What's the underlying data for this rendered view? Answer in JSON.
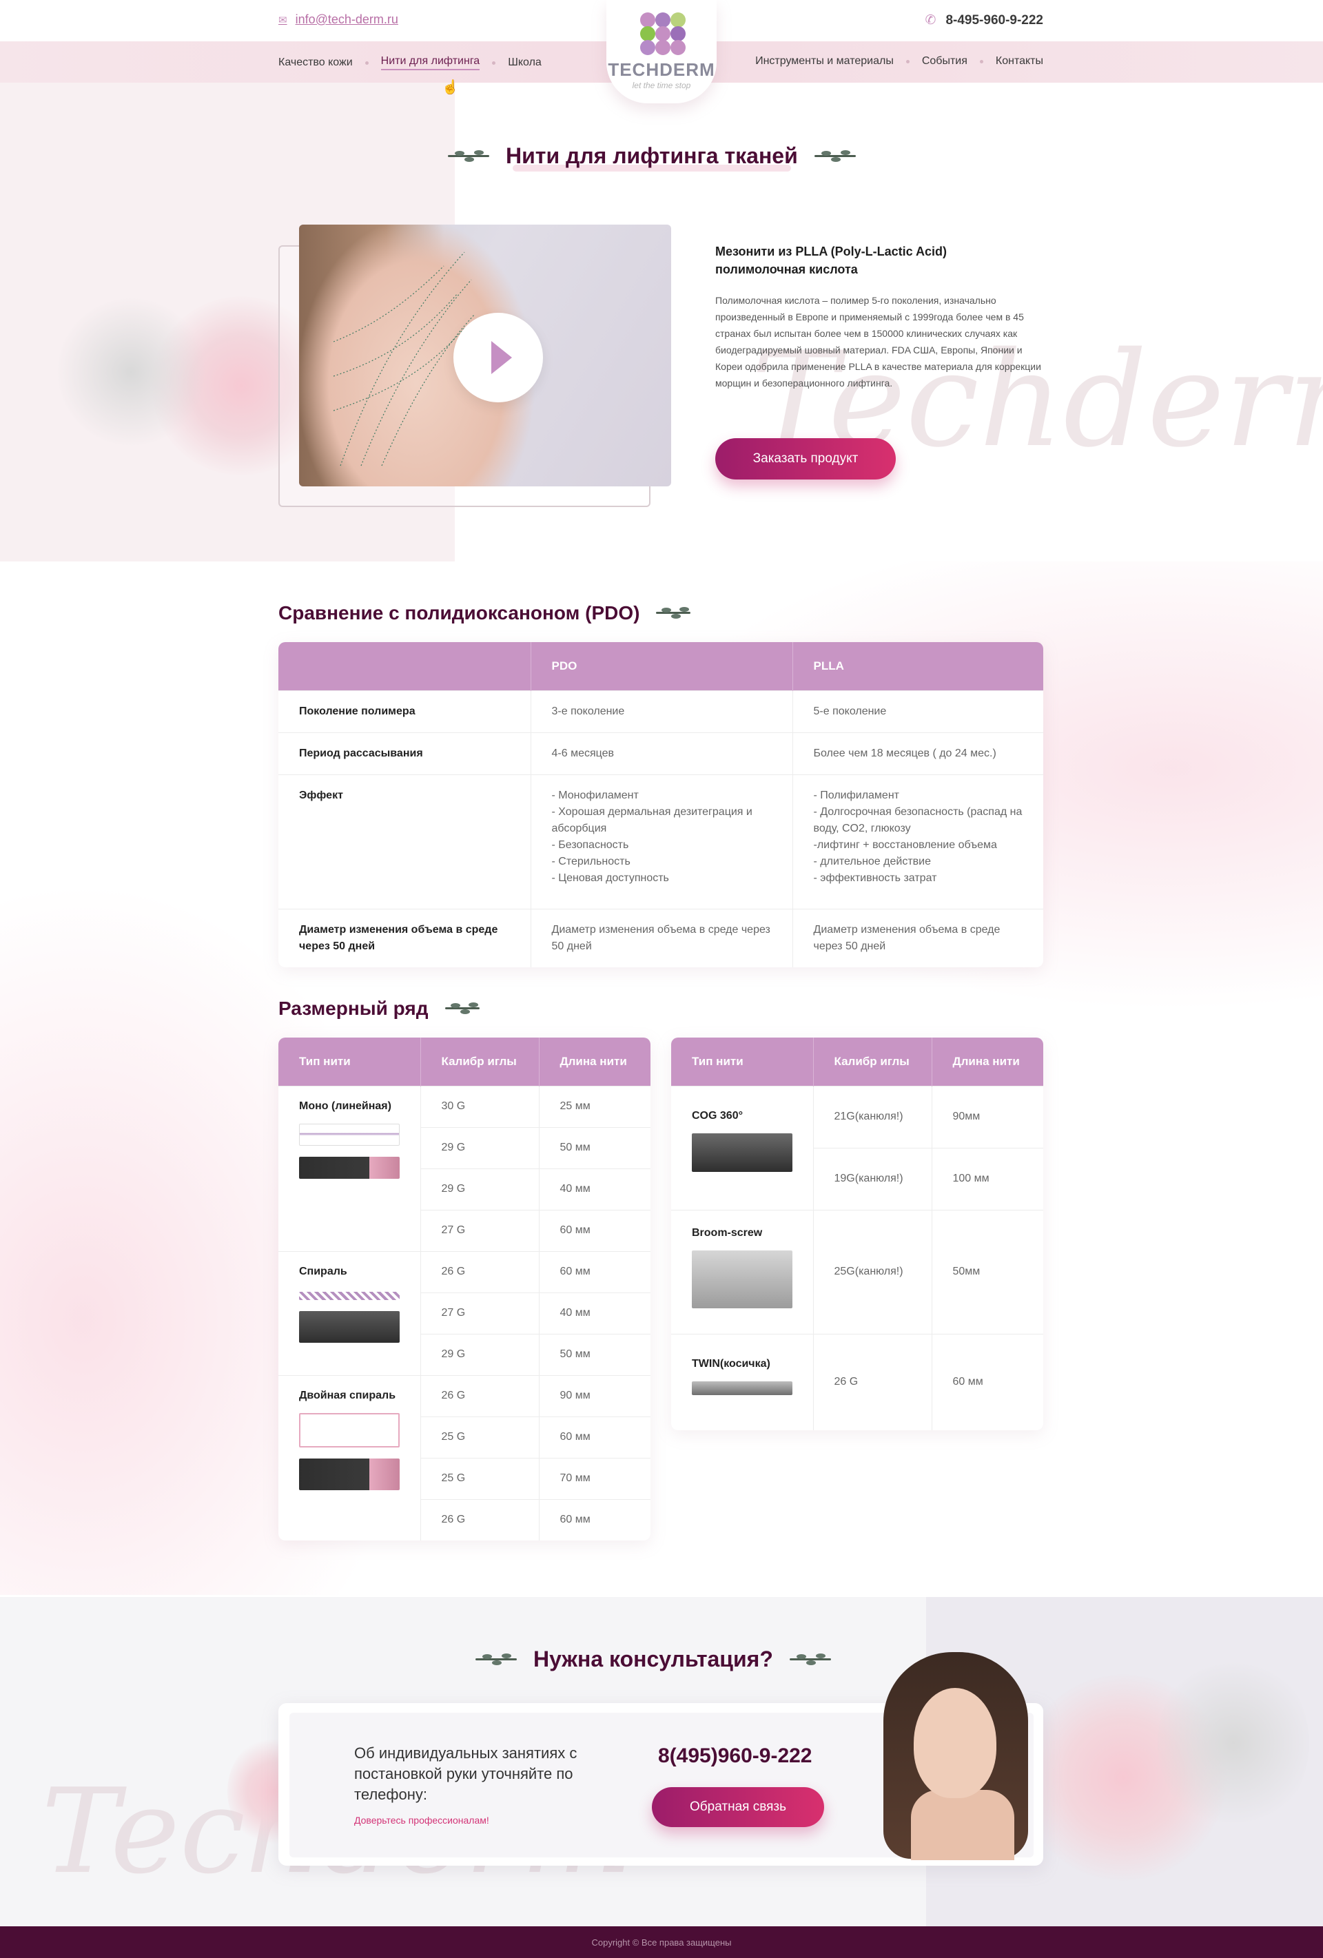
{
  "header": {
    "email": "info@tech-derm.ru",
    "phone": "8-495-960-9-222",
    "nav_left": [
      "Качество кожи",
      "Нити для лифтинга",
      "Школа"
    ],
    "nav_right": [
      "Инструменты и материалы",
      "События",
      "Контакты"
    ],
    "active_nav": "Нити для лифтинга",
    "logo_name": "TECHDERM",
    "logo_tagline": "let the time stop"
  },
  "page_title": "Нити для лифтинга тканей",
  "watermark": "Techderm",
  "product": {
    "title": "Мезонити из PLLA (Poly-L-Lactic Acid) полимолочная кислота",
    "description": "Полимолочная кислота – полимер 5-го поколения, изначально произведенный в Европе и применяемый с 1999года более чем в 45 странах был испытан более чем в 150000 клинических случаях как биодеградируемый шовный материал. FDA США, Европы, Японии и Кореи одобрила применение PLLA в качестве материала для коррекции морщин и безоперационного лифтинга.",
    "order_button": "Заказать продукт"
  },
  "comparison": {
    "title": "Сравнение с полидиоксаноном (PDO)",
    "headers": [
      "",
      "PDO",
      "PLLA"
    ],
    "rows": [
      {
        "label": "Поколение полимера",
        "pdo": "3-е поколение",
        "plla": "5-е поколение"
      },
      {
        "label": "Период рассасывания",
        "pdo": "4-6 месяцев",
        "plla": "Более чем 18 месяцев ( до 24 мес.)"
      },
      {
        "label": "Эффект",
        "pdo": [
          "- Монофиламент",
          "- Хорошая дермальная дезитеграция и абсорбция",
          "- Безопасность",
          "- Стерильность",
          "- Ценовая доступность"
        ],
        "plla": [
          "- Полифиламент",
          "- Долгосрочная безопасность (распад на воду, CO2, глюкозу",
          "-лифтинг + восстановление объема",
          "- длительное действие",
          "- эффективность затрат"
        ]
      },
      {
        "label": "Диаметр изменения объема в среде через 50 дней",
        "pdo": "Диаметр изменения объема в среде через 50 дней",
        "plla": "Диаметр изменения объема в среде через 50 дней"
      }
    ]
  },
  "sizes": {
    "title": "Размерный ряд",
    "headers": [
      "Тип нити",
      "Калибр иглы",
      "Длина нити"
    ],
    "left": [
      {
        "type": "Моно (линейная)",
        "rows": [
          [
            "30 G",
            "25 мм"
          ],
          [
            "29 G",
            "50 мм"
          ],
          [
            "29 G",
            "40 мм"
          ],
          [
            "27 G",
            "60 мм"
          ]
        ]
      },
      {
        "type": "Спираль",
        "rows": [
          [
            "26 G",
            "60 мм"
          ],
          [
            "27 G",
            "40 мм"
          ],
          [
            "29 G",
            "50 мм"
          ]
        ]
      },
      {
        "type": "Двойная спираль",
        "rows": [
          [
            "26 G",
            "90 мм"
          ],
          [
            "25 G",
            "60 мм"
          ],
          [
            "25 G",
            "70 мм"
          ],
          [
            "26 G",
            "60 мм"
          ]
        ]
      }
    ],
    "right": [
      {
        "type": "COG 360°",
        "rows": [
          [
            "21G(канюля!)",
            "90мм"
          ],
          [
            "19G(канюля!)",
            "100 мм"
          ]
        ]
      },
      {
        "type": "Broom-screw",
        "rows": [
          [
            "25G(канюля!)",
            "50мм"
          ]
        ]
      },
      {
        "type": "TWIN(косичка)",
        "rows": [
          [
            "26 G",
            "60 мм"
          ]
        ]
      }
    ]
  },
  "consult": {
    "title": "Нужна консультация?",
    "text": "Об индивидуальных занятиях с постановкой руки уточняйте по телефону:",
    "link": "Доверьтесь профессионалам!",
    "phone": "8(495)960-9-222",
    "button": "Обратная связь"
  },
  "footer": {
    "copyright": "Copyright © Все права защищены"
  },
  "colors": {
    "accent": "#c895c4",
    "brand_dark": "#4b0d35",
    "button_from": "#9c1d6a",
    "button_to": "#d8306e"
  }
}
